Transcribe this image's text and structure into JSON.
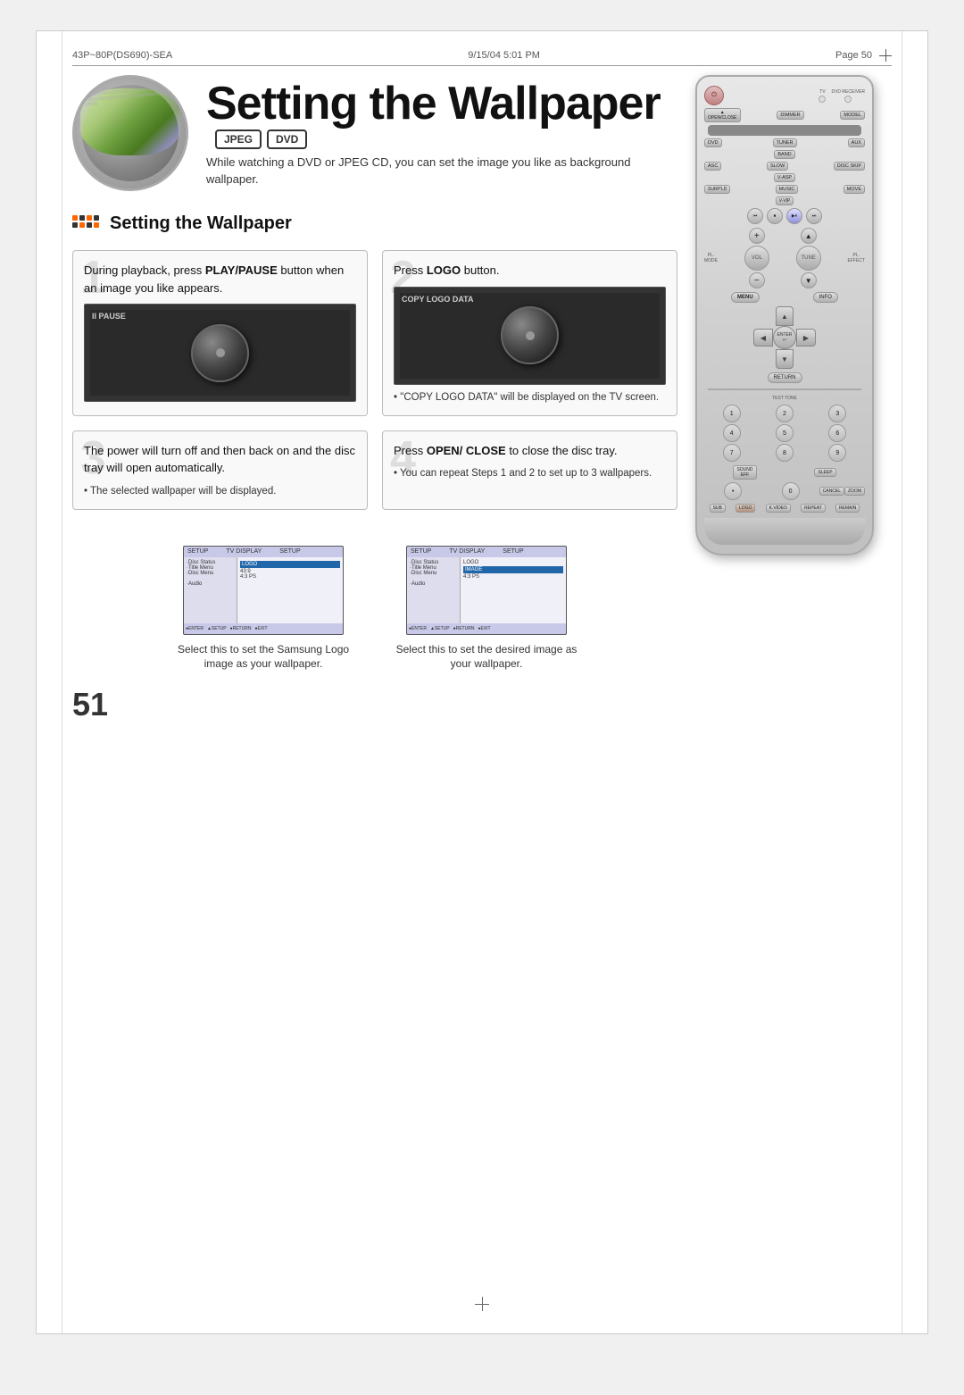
{
  "header": {
    "left": "43P~80P(DS690)-SEA",
    "middle": "9/15/04  5:01 PM",
    "right": "Page  50"
  },
  "title": {
    "main": "Setting the Wallpaper",
    "badge1": "JPEG",
    "badge2": "DVD",
    "subtitle": "While watching a DVD or JPEG CD, you can set the image you like as background wallpaper."
  },
  "section": {
    "heading": "Setting the Wallpaper"
  },
  "steps": [
    {
      "number": "1",
      "text_plain": "During playback, press ",
      "text_bold": "PLAY/PAUSE",
      "text_after": " button when an image you like appears.",
      "screen_label": "II PAUSE"
    },
    {
      "number": "2",
      "text_plain": "Press ",
      "text_bold": "LOGO",
      "text_after": " button.",
      "screen_label": "COPY LOGO DATA",
      "note": "\"COPY LOGO DATA\" will be displayed on the TV screen."
    },
    {
      "number": "3",
      "text_plain": "The power will turn off and then back on and the disc tray will open automatically.",
      "note": "The selected wallpaper will be displayed."
    },
    {
      "number": "4",
      "text_plain": "Press ",
      "text_bold": "OPEN/ CLOSE",
      "text_after": " to close the disc tray.",
      "note": "You can repeat Steps 1 and 2 to set up to 3 wallpapers."
    }
  ],
  "screenshots": [
    {
      "caption": "Select this to set the Samsung Logo image as your wallpaper.",
      "menu_title": "TV DISPLAY",
      "highlight": "LOGO"
    },
    {
      "caption": "Select this to set the desired image as your wallpaper.",
      "menu_title": "TV DISPLAY",
      "highlight": "IMAGE"
    }
  ],
  "page_number": "51",
  "remote": {
    "power_label": "⏻",
    "tv_label": "TV",
    "dvd_label": "DVD RECEIVER",
    "buttons": {
      "open_close": "OPEN/CLOSE",
      "dimmer": "DIMMER",
      "model": "MODEL",
      "dvd": "DVD",
      "tuner": "TUNER",
      "aux": "AUX",
      "band": "BAND",
      "asc": "ASC",
      "slow": "SLOW",
      "disc_skip": "DISC SKIP",
      "v_asp": "V-ASP",
      "surround": "SURP'LD",
      "music": "MUSIC",
      "move": "MOVE",
      "v_vip": "V-VIP",
      "menu": "MENU",
      "info": "INFO",
      "enter": "ENTER",
      "return": "RETURN",
      "test_tone": "TEST TONE",
      "sound_eff": "SOUND EFF",
      "sleep": "SLEEP",
      "cancel": "CANCEL",
      "zoom": "ZOOM",
      "sub": "SUB",
      "logo": "LOGO",
      "k_video": "K.VIDEO",
      "repeat": "REPEAT",
      "remain": "REMAIN"
    }
  }
}
